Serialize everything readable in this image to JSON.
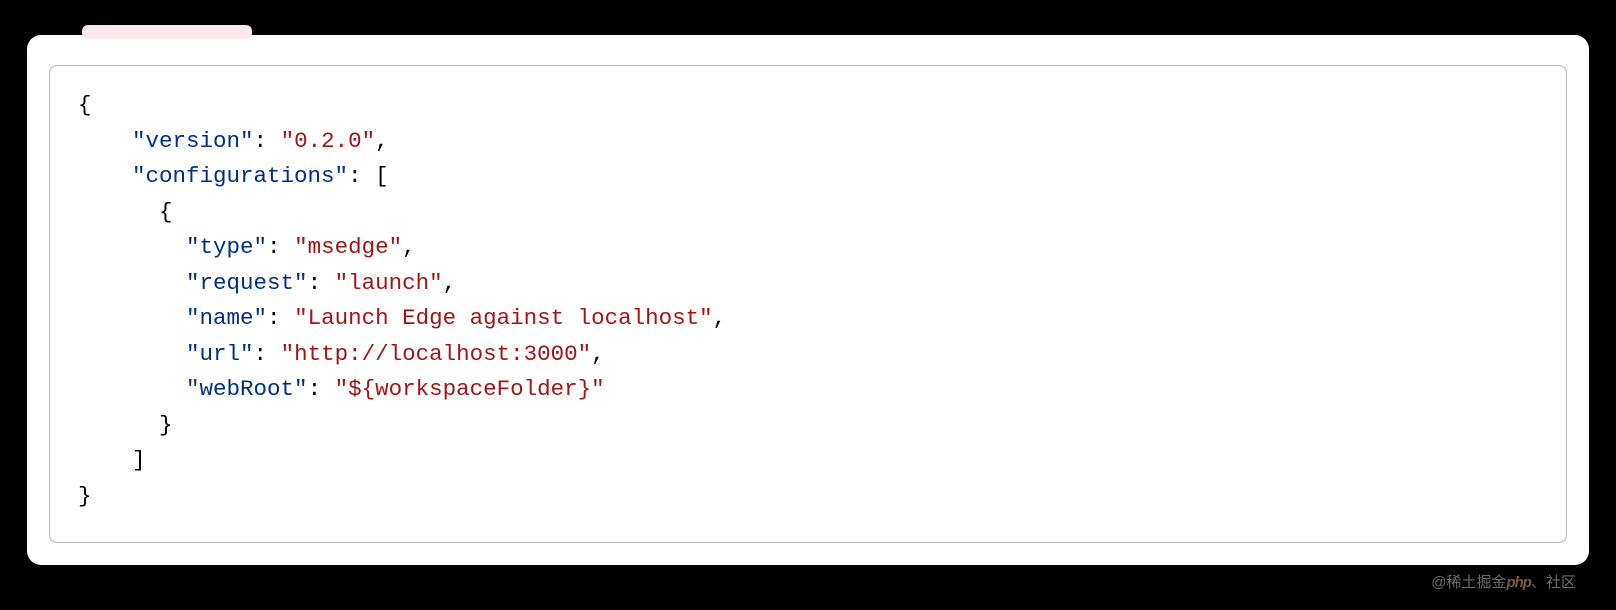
{
  "code": {
    "tokens": [
      {
        "cls": "pn",
        "text": "{\n"
      },
      {
        "cls": "pn",
        "text": "    "
      },
      {
        "cls": "key",
        "text": "\"version\""
      },
      {
        "cls": "colon",
        "text": ": "
      },
      {
        "cls": "str",
        "text": "\"0.2.0\""
      },
      {
        "cls": "pn",
        "text": ",\n"
      },
      {
        "cls": "pn",
        "text": "    "
      },
      {
        "cls": "key",
        "text": "\"configurations\""
      },
      {
        "cls": "colon",
        "text": ": "
      },
      {
        "cls": "pn",
        "text": "[\n"
      },
      {
        "cls": "pn",
        "text": "      {\n"
      },
      {
        "cls": "pn",
        "text": "        "
      },
      {
        "cls": "key",
        "text": "\"type\""
      },
      {
        "cls": "colon",
        "text": ": "
      },
      {
        "cls": "str",
        "text": "\"msedge\""
      },
      {
        "cls": "pn",
        "text": ",\n"
      },
      {
        "cls": "pn",
        "text": "        "
      },
      {
        "cls": "key",
        "text": "\"request\""
      },
      {
        "cls": "colon",
        "text": ": "
      },
      {
        "cls": "str",
        "text": "\"launch\""
      },
      {
        "cls": "pn",
        "text": ",\n"
      },
      {
        "cls": "pn",
        "text": "        "
      },
      {
        "cls": "key",
        "text": "\"name\""
      },
      {
        "cls": "colon",
        "text": ": "
      },
      {
        "cls": "str",
        "text": "\"Launch Edge against localhost\""
      },
      {
        "cls": "pn",
        "text": ",\n"
      },
      {
        "cls": "pn",
        "text": "        "
      },
      {
        "cls": "key",
        "text": "\"url\""
      },
      {
        "cls": "colon",
        "text": ": "
      },
      {
        "cls": "str",
        "text": "\"http://localhost:3000\""
      },
      {
        "cls": "pn",
        "text": ",\n"
      },
      {
        "cls": "pn",
        "text": "        "
      },
      {
        "cls": "key",
        "text": "\"webRoot\""
      },
      {
        "cls": "colon",
        "text": ": "
      },
      {
        "cls": "str",
        "text": "\"${workspaceFolder}\""
      },
      {
        "cls": "pn",
        "text": "\n"
      },
      {
        "cls": "pn",
        "text": "      }\n"
      },
      {
        "cls": "pn",
        "text": "    ]\n"
      },
      {
        "cls": "pn",
        "text": "}"
      }
    ]
  },
  "watermark": {
    "prefix": "@稀土掘金",
    "brand": "php",
    "suffix": "、社区"
  }
}
